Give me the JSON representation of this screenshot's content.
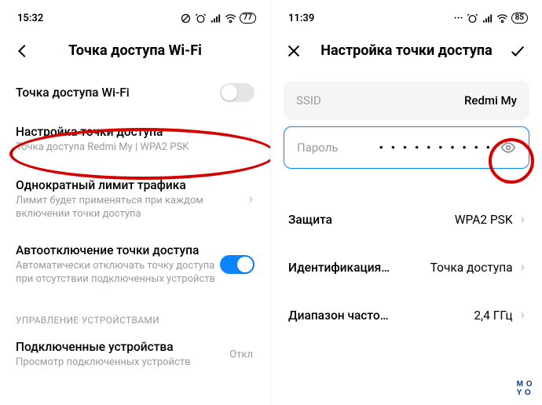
{
  "left": {
    "time": "15:32",
    "battery": "77",
    "title": "Точка доступа Wi-Fi",
    "items": {
      "hotspot_toggle": {
        "label": "Точка доступа Wi-Fi"
      },
      "configure": {
        "label": "Настройка точки доступа",
        "sub": "Точка доступа Redmi My | WPA2 PSK"
      },
      "limit": {
        "label": "Однократный лимит трафика",
        "sub": "Лимит будет применяться при каждом включении точки доступа"
      },
      "auto_off": {
        "label": "Автоотключение точки доступа",
        "sub": "Автоматически отключать точку доступа при отсутствии подключенных устройств"
      }
    },
    "section_devices": "УПРАВЛЕНИЕ УСТРОЙСТВАМИ",
    "connected": {
      "label": "Подключенные устройства",
      "sub": "Просмотр подключенных устройств",
      "value": "Откл"
    }
  },
  "right": {
    "time": "11:39",
    "battery": "85",
    "title": "Настройка точки доступа",
    "ssid": {
      "label": "SSID",
      "value": "Redmi My"
    },
    "password": {
      "label": "Пароль",
      "mask": "• • • • • • • • • •"
    },
    "security": {
      "label": "Защита",
      "value": "WPA2 PSK"
    },
    "ident": {
      "label": "Идентификация…",
      "value": "Точка доступа"
    },
    "band": {
      "label": "Диапазон часто…",
      "value": "2,4 ГГц"
    }
  },
  "logo": {
    "l1": "M O",
    "l2": "Y O"
  }
}
